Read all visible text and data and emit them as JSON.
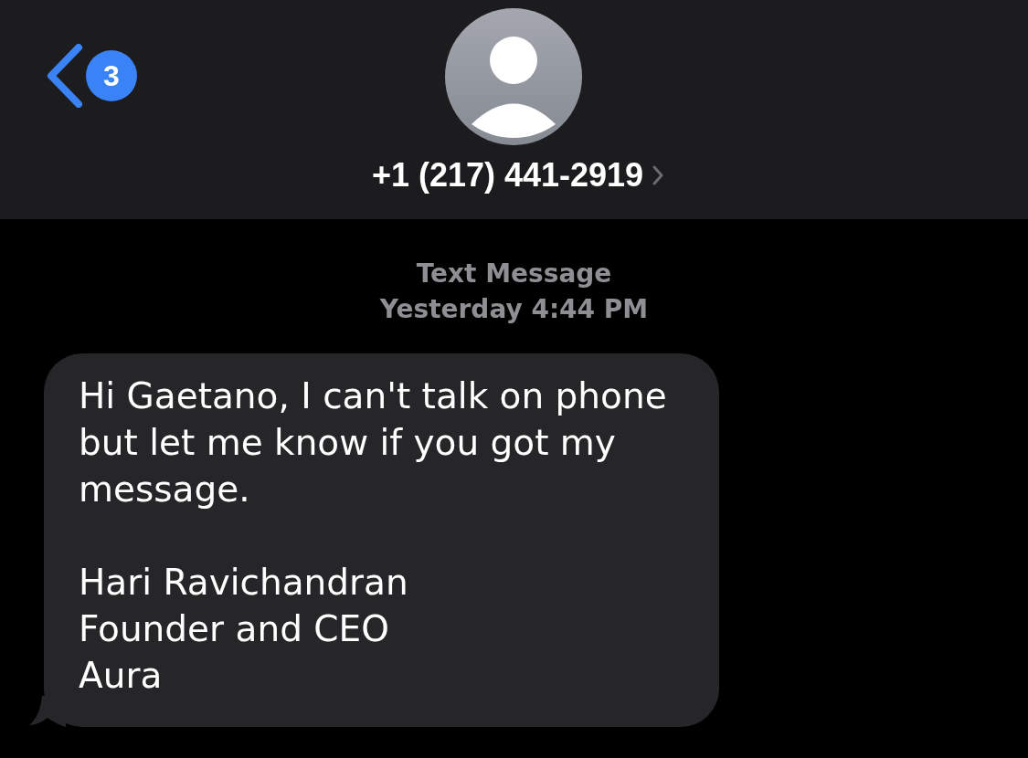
{
  "header": {
    "back_badge": "3",
    "contact": "+1 (217) 441-2919"
  },
  "conversation": {
    "service": "Text Message",
    "timestamp": "Yesterday 4:44 PM",
    "messages": [
      {
        "kind": "incoming",
        "text": "Hi Gaetano, I can't talk on phone but let me know if you got my message.\n\nHari Ravichandran\nFounder and CEO\nAura"
      }
    ]
  }
}
